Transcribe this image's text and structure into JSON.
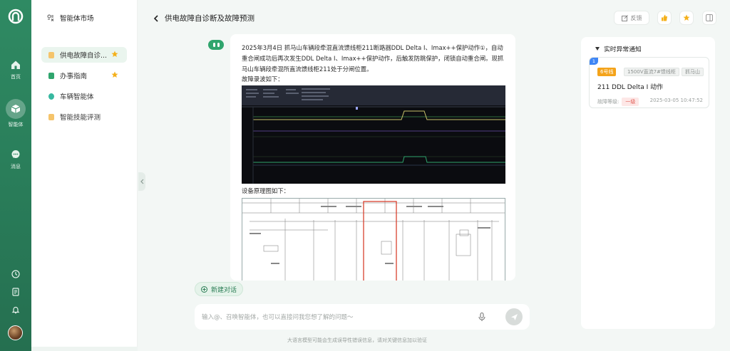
{
  "rail": {
    "items": [
      {
        "label": "首页",
        "icon": "home-icon"
      },
      {
        "label": "智能体",
        "icon": "cube-icon"
      },
      {
        "label": "消息",
        "icon": "chat-icon"
      }
    ],
    "bottom_icons": [
      "history-icon",
      "document-icon",
      "bell-icon"
    ]
  },
  "sidebar": {
    "title": "智能体市场",
    "items": [
      {
        "label": "供电故障自诊...",
        "color": "#f5c46b",
        "starred": true
      },
      {
        "label": "办事指南",
        "color": "#2fa56d",
        "starred": true
      },
      {
        "label": "车辆智能体",
        "color": "#37b8a0",
        "starred": false
      },
      {
        "label": "智能技能评测",
        "color": "#f5c46b",
        "starred": false
      }
    ]
  },
  "header": {
    "title": "供电故障自诊断及故障预测",
    "feedback_label": "反馈"
  },
  "message": {
    "text": "2025年3月4日 抓马山车辆段牵混直流馈线柜211断路器DDL Delta I、Imax++保护动作①，自动重合闸成功后再次发生DDL Delta I、Imax++保护动作，后触发防跳保护，闭锁自动重合闸。现抓马山车辆段牵混所直流馈线柜211处于分闸位置。",
    "wave_caption": "故障录波如下：",
    "schematic_caption": "设备原理图如下："
  },
  "composer": {
    "new_chat_label": "新建对话",
    "placeholder": "输入@、召唤智能体，也可以直接问我您想了解的问题～",
    "disclaimer": "大语言模型可能会生成误导性错误信息，请对关键信息加以验证"
  },
  "alerts": {
    "title": "实时异常通知",
    "items": [
      {
        "index": "1",
        "line_tag": "6号线",
        "cabinet_tag": "1500V直流7#馈线柜",
        "station_tag": "抓马山",
        "title": "211 DDL Delta I 动作",
        "level_label": "故障等级:",
        "level_value": "一级",
        "time": "2025-03-05 10:47:52"
      }
    ]
  },
  "colors": {
    "brand": "#2f8a63",
    "accent": "#2fa56d",
    "warning": "#f4a31a",
    "danger": "#e05a52"
  }
}
